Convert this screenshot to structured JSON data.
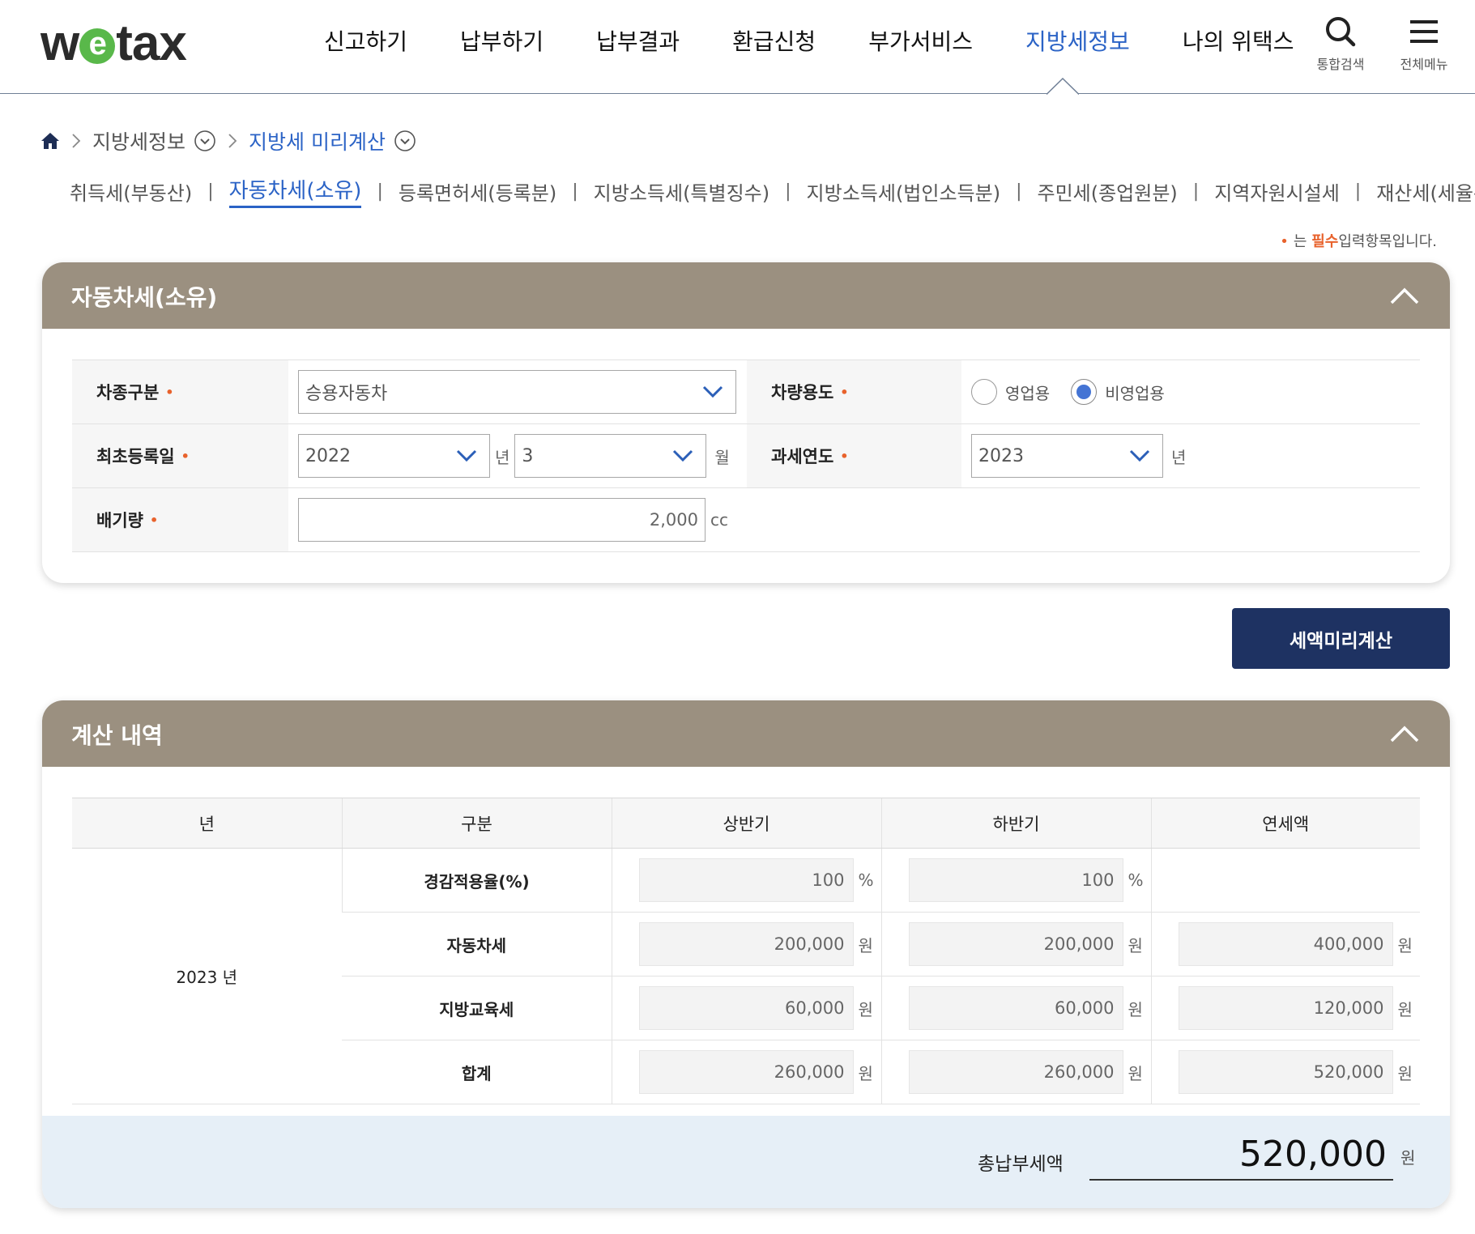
{
  "header": {
    "logo_pre": "w",
    "logo_e": "e",
    "logo_post": "tax",
    "nav": [
      "신고하기",
      "납부하기",
      "납부결과",
      "환급신청",
      "부가서비스",
      "지방세정보",
      "나의 위택스"
    ],
    "active_nav": "지방세정보",
    "search_label": "통합검색",
    "menu_label": "전체메뉴"
  },
  "breadcrumb": {
    "home_icon": "home-icon",
    "level1": "지방세정보",
    "level2": "지방세 미리계산"
  },
  "subtabs": [
    "취득세(부동산)",
    "자동차세(소유)",
    "등록면허세(등록분)",
    "지방소득세(특별징수)",
    "지방소득세(법인소득분)",
    "주민세(종업원분)",
    "지역자원시설세",
    "재산세(세율특례)"
  ],
  "active_subtab": "자동차세(소유)",
  "required_note": {
    "dot": "•",
    "pre": "는",
    "must": "필수",
    "post": "입력항목입니다."
  },
  "form_panel": {
    "title": "자동차세(소유)",
    "vehicle_type_label": "차종구분",
    "vehicle_type_value": "승용자동차",
    "usage_label": "차량용도",
    "usage_options": [
      "영업용",
      "비영업용"
    ],
    "usage_selected": "비영업용",
    "first_reg_label": "최초등록일",
    "first_reg_year": "2022",
    "year_unit": "년",
    "first_reg_month": "3",
    "month_unit": "월",
    "tax_year_label": "과세연도",
    "tax_year_value": "2023",
    "tax_year_unit": "년",
    "displacement_label": "배기량",
    "displacement_value": "2,000",
    "displacement_unit": "cc",
    "required_mark": "•"
  },
  "calc_button": "세액미리계산",
  "result_panel": {
    "title": "계산 내역",
    "headers": [
      "년",
      "구분",
      "상반기",
      "하반기",
      "연세액"
    ],
    "year": "2023 년",
    "rows": [
      {
        "label": "경감적용율(%)",
        "first": "100",
        "second": "100",
        "annual": "",
        "unit": "%"
      },
      {
        "label": "자동차세",
        "first": "200,000",
        "second": "200,000",
        "annual": "400,000",
        "unit": "원"
      },
      {
        "label": "지방교육세",
        "first": "60,000",
        "second": "60,000",
        "annual": "120,000",
        "unit": "원"
      },
      {
        "label": "합계",
        "first": "260,000",
        "second": "260,000",
        "annual": "520,000",
        "unit": "원"
      }
    ],
    "total_label": "총납부세액",
    "total_value": "520,000",
    "total_unit": "원"
  },
  "colors": {
    "accent_blue": "#2b63c6",
    "panel_header": "#9b9080",
    "button_navy": "#1e3262",
    "required_orange": "#e8622c",
    "total_bg": "#e6eff7"
  }
}
